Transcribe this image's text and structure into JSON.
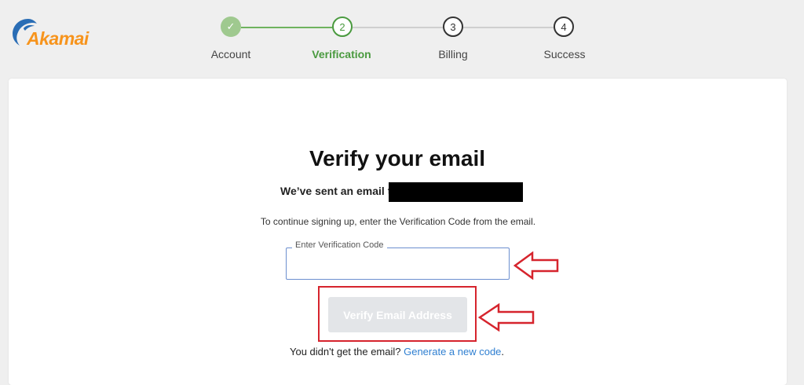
{
  "brand": {
    "name": "Akamai",
    "color": "#f7941d"
  },
  "stepper": {
    "steps": [
      {
        "number": "✓",
        "label": "Account",
        "state": "done"
      },
      {
        "number": "2",
        "label": "Verification",
        "state": "active"
      },
      {
        "number": "3",
        "label": "Billing",
        "state": "pending"
      },
      {
        "number": "4",
        "label": "Success",
        "state": "pending"
      }
    ],
    "colors": {
      "done": "#9fc98f",
      "active": "#4a9a3f",
      "pending": "#cccccc"
    }
  },
  "main": {
    "title": "Verify your email",
    "sent_prefix": "We’ve sent an email to",
    "instructions": "To continue signing up, enter the Verification Code from the email.",
    "code_field": {
      "label": "Enter Verification Code",
      "value": ""
    },
    "verify_button": "Verify Email Address",
    "footer_prefix": "You didn't get the email? ",
    "footer_link": "Generate a new code",
    "footer_suffix": "."
  },
  "annotation_color": "#d6242d"
}
